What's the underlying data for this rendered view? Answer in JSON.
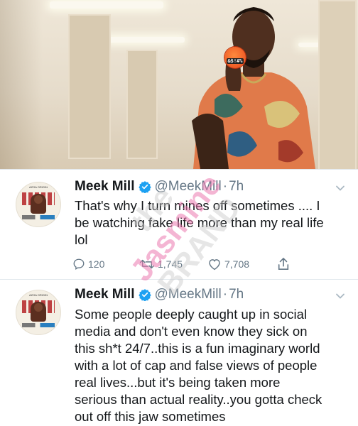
{
  "photo": {
    "badge_text": "&$!#%"
  },
  "watermark": {
    "line1": "the",
    "line2": "Jasmine",
    "line3": "BRAND"
  },
  "tweets": [
    {
      "name": "Meek Mill",
      "handle": "@MeekMill",
      "separator": "·",
      "time": "7h",
      "text": "That's why I turn mines off sometimes .... I\nbe watching fake life more than my real life\nlol",
      "replies": "120",
      "retweets": "1,745",
      "likes": "7,708"
    },
    {
      "name": "Meek Mill",
      "handle": "@MeekMill",
      "separator": "·",
      "time": "7h",
      "text": "Some people deeply caught up in social\nmedia and don't even know they sick on\nthis sh*t 24/7..this is a fun imaginary world\nwith a lot of cap and false views of people\nreal lives...but it's being taken more\nserious than actual reality..you gotta check\nout off this jaw  sometimes"
    }
  ],
  "colors": {
    "verified": "#1da1f2",
    "text": "#14171a",
    "muted": "#657786"
  }
}
